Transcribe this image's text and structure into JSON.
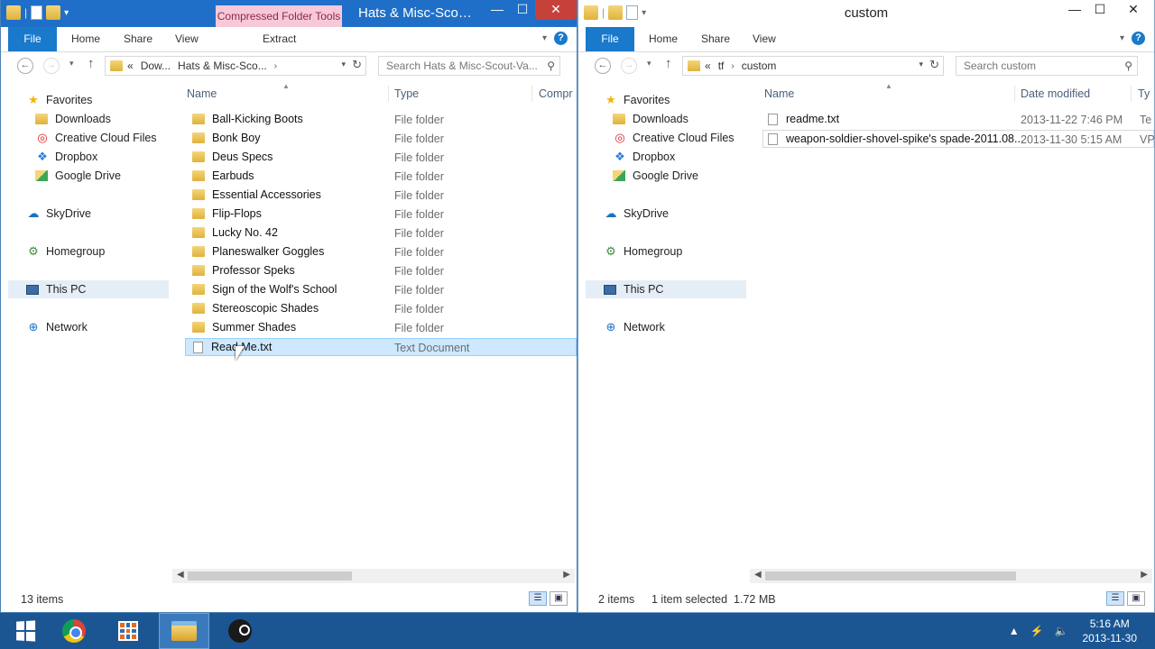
{
  "left_window": {
    "title": "Hats & Misc-Scou...",
    "context_tab": "Compressed Folder Tools",
    "ribbon_tabs": [
      "File",
      "Home",
      "Share",
      "View",
      "Extract"
    ],
    "breadcrumb": [
      "«",
      "Dow...",
      "Hats & Misc-Sco..."
    ],
    "search_placeholder": "Search Hats & Misc-Scout-Va...",
    "columns": [
      "Name",
      "Type",
      "Compr"
    ],
    "files": [
      {
        "name": "Ball-Kicking Boots",
        "type": "File folder",
        "icon": "folder-icon"
      },
      {
        "name": "Bonk Boy",
        "type": "File folder",
        "icon": "folder-icon"
      },
      {
        "name": "Deus Specs",
        "type": "File folder",
        "icon": "folder-icon"
      },
      {
        "name": "Earbuds",
        "type": "File folder",
        "icon": "folder-icon"
      },
      {
        "name": "Essential Accessories",
        "type": "File folder",
        "icon": "folder-icon"
      },
      {
        "name": "Flip-Flops",
        "type": "File folder",
        "icon": "folder-icon"
      },
      {
        "name": "Lucky No. 42",
        "type": "File folder",
        "icon": "folder-icon"
      },
      {
        "name": "Planeswalker Goggles",
        "type": "File folder",
        "icon": "folder-icon"
      },
      {
        "name": "Professor Speks",
        "type": "File folder",
        "icon": "folder-icon"
      },
      {
        "name": "Sign of the Wolf's School",
        "type": "File folder",
        "icon": "folder-icon"
      },
      {
        "name": "Stereoscopic Shades",
        "type": "File folder",
        "icon": "folder-icon"
      },
      {
        "name": "Summer Shades",
        "type": "File folder",
        "icon": "folder-icon"
      },
      {
        "name": "Read Me.txt",
        "type": "Text Document",
        "icon": "text-file-icon",
        "selected": true
      }
    ],
    "status": "13 items"
  },
  "right_window": {
    "title": "custom",
    "ribbon_tabs": [
      "File",
      "Home",
      "Share",
      "View"
    ],
    "breadcrumb": [
      "«",
      "tf",
      "custom"
    ],
    "search_placeholder": "Search custom",
    "columns": [
      "Name",
      "Date modified",
      "Ty"
    ],
    "files": [
      {
        "name": "readme.txt",
        "date": "2013-11-22 7:46 PM",
        "type": "Te",
        "icon": "text-file-icon"
      },
      {
        "name": "weapon-soldier-shovel-spike's spade-2011.08...",
        "date": "2013-11-30 5:15 AM",
        "type": "VP",
        "icon": "file-icon"
      }
    ],
    "status_count": "2 items",
    "status_selected": "1 item selected  1.72 MB"
  },
  "nav_pane": {
    "favorites": "Favorites",
    "downloads": "Downloads",
    "creative_cloud": "Creative Cloud Files",
    "dropbox": "Dropbox",
    "google_drive": "Google Drive",
    "skydrive": "SkyDrive",
    "homegroup": "Homegroup",
    "this_pc": "This PC",
    "network": "Network"
  },
  "taskbar": {
    "time": "5:16 AM",
    "date": "2013-11-30",
    "apps": [
      "start-icon",
      "chrome-icon",
      "apps-icon",
      "file-explorer-icon",
      "steam-icon"
    ]
  },
  "colors": {
    "accent": "#1979ca",
    "titlebar": "#1f6fc8",
    "taskbar": "#1b5693",
    "selection": "#cde8ff"
  }
}
